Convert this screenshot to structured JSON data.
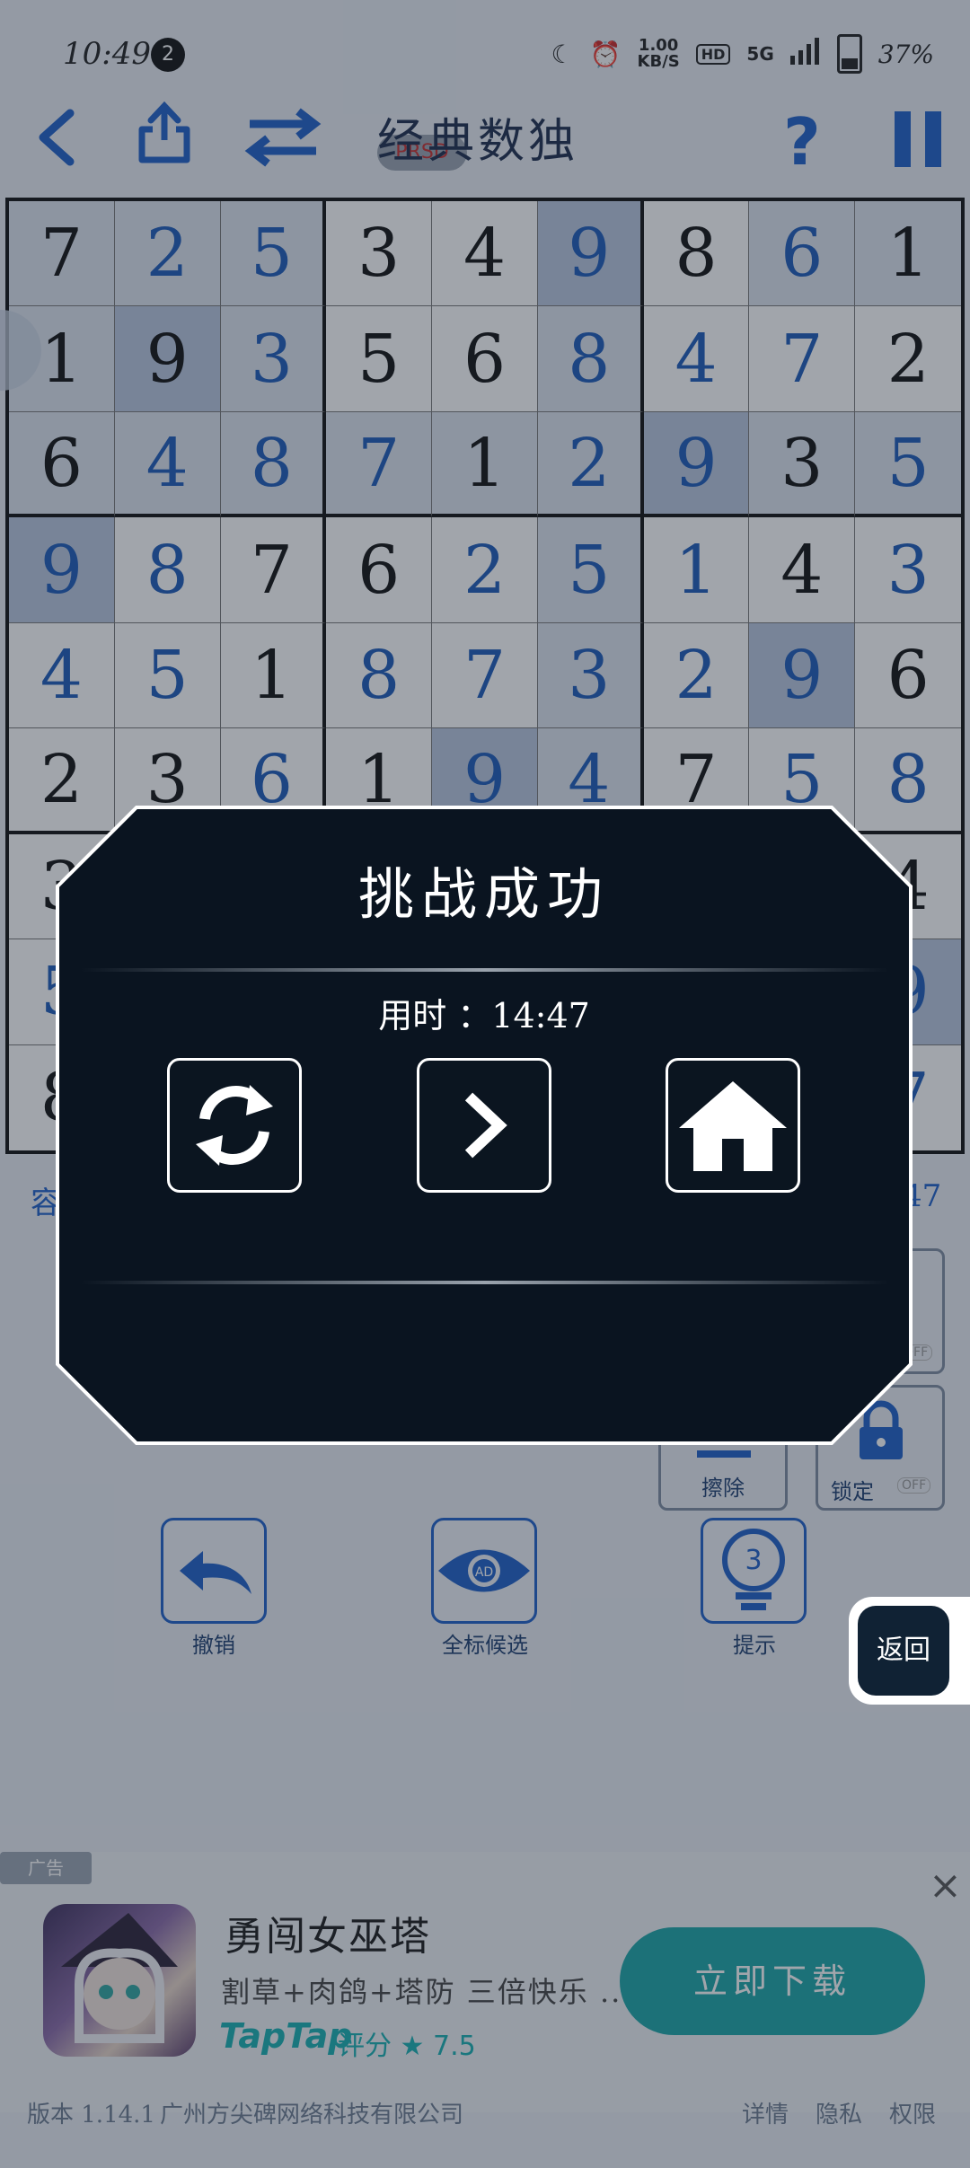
{
  "status_bar": {
    "time": "10:49",
    "notification_count": "2",
    "speed_value": "1.00",
    "speed_unit": "KB/S",
    "hd": "HD",
    "network": "5G",
    "battery": "37%"
  },
  "toolbar": {
    "title": "经典数独",
    "badge": "PRSD",
    "help": "?"
  },
  "grid": {
    "rows": [
      [
        {
          "v": "7",
          "t": "given",
          "bg": "hl"
        },
        {
          "v": "2",
          "t": "entered",
          "bg": "hl"
        },
        {
          "v": "5",
          "t": "entered",
          "bg": "hl"
        },
        {
          "v": "3",
          "t": "given",
          "bg": ""
        },
        {
          "v": "4",
          "t": "given",
          "bg": ""
        },
        {
          "v": "9",
          "t": "entered",
          "bg": "sel"
        },
        {
          "v": "8",
          "t": "given",
          "bg": ""
        },
        {
          "v": "6",
          "t": "entered",
          "bg": "hl"
        },
        {
          "v": "1",
          "t": "given",
          "bg": "hl"
        }
      ],
      [
        {
          "v": "1",
          "t": "given",
          "bg": "hl"
        },
        {
          "v": "9",
          "t": "given",
          "bg": "sel"
        },
        {
          "v": "3",
          "t": "entered",
          "bg": "hl"
        },
        {
          "v": "5",
          "t": "given",
          "bg": ""
        },
        {
          "v": "6",
          "t": "given",
          "bg": ""
        },
        {
          "v": "8",
          "t": "entered",
          "bg": "hl"
        },
        {
          "v": "4",
          "t": "entered",
          "bg": ""
        },
        {
          "v": "7",
          "t": "entered",
          "bg": ""
        },
        {
          "v": "2",
          "t": "given",
          "bg": ""
        }
      ],
      [
        {
          "v": "6",
          "t": "given",
          "bg": "hl"
        },
        {
          "v": "4",
          "t": "entered",
          "bg": "hl"
        },
        {
          "v": "8",
          "t": "entered",
          "bg": "hl"
        },
        {
          "v": "7",
          "t": "entered",
          "bg": "hl"
        },
        {
          "v": "1",
          "t": "given",
          "bg": "hl"
        },
        {
          "v": "2",
          "t": "entered",
          "bg": "hl"
        },
        {
          "v": "9",
          "t": "entered",
          "bg": "sel"
        },
        {
          "v": "3",
          "t": "given",
          "bg": "hl"
        },
        {
          "v": "5",
          "t": "entered",
          "bg": "hl"
        }
      ],
      [
        {
          "v": "9",
          "t": "entered",
          "bg": "sel"
        },
        {
          "v": "8",
          "t": "entered",
          "bg": ""
        },
        {
          "v": "7",
          "t": "given",
          "bg": ""
        },
        {
          "v": "6",
          "t": "given",
          "bg": ""
        },
        {
          "v": "2",
          "t": "entered",
          "bg": ""
        },
        {
          "v": "5",
          "t": "entered",
          "bg": "hl"
        },
        {
          "v": "1",
          "t": "entered",
          "bg": ""
        },
        {
          "v": "4",
          "t": "given",
          "bg": ""
        },
        {
          "v": "3",
          "t": "entered",
          "bg": ""
        }
      ],
      [
        {
          "v": "4",
          "t": "entered",
          "bg": ""
        },
        {
          "v": "5",
          "t": "entered",
          "bg": ""
        },
        {
          "v": "1",
          "t": "given",
          "bg": ""
        },
        {
          "v": "8",
          "t": "entered",
          "bg": ""
        },
        {
          "v": "7",
          "t": "entered",
          "bg": ""
        },
        {
          "v": "3",
          "t": "entered",
          "bg": "hl"
        },
        {
          "v": "2",
          "t": "entered",
          "bg": ""
        },
        {
          "v": "9",
          "t": "entered",
          "bg": "sel"
        },
        {
          "v": "6",
          "t": "given",
          "bg": ""
        }
      ],
      [
        {
          "v": "2",
          "t": "given",
          "bg": ""
        },
        {
          "v": "3",
          "t": "given",
          "bg": ""
        },
        {
          "v": "6",
          "t": "entered",
          "bg": ""
        },
        {
          "v": "1",
          "t": "given",
          "bg": ""
        },
        {
          "v": "9",
          "t": "entered",
          "bg": "sel"
        },
        {
          "v": "4",
          "t": "entered",
          "bg": "hl"
        },
        {
          "v": "7",
          "t": "given",
          "bg": ""
        },
        {
          "v": "5",
          "t": "entered",
          "bg": ""
        },
        {
          "v": "8",
          "t": "entered",
          "bg": ""
        }
      ],
      [
        {
          "v": "3",
          "t": "given",
          "bg": ""
        },
        {
          "v": "",
          "t": "given",
          "bg": ""
        },
        {
          "v": "",
          "t": "given",
          "bg": ""
        },
        {
          "v": "",
          "t": "given",
          "bg": ""
        },
        {
          "v": "",
          "t": "given",
          "bg": ""
        },
        {
          "v": "",
          "t": "given",
          "bg": "hl"
        },
        {
          "v": "",
          "t": "given",
          "bg": ""
        },
        {
          "v": "",
          "t": "given",
          "bg": ""
        },
        {
          "v": "4",
          "t": "given",
          "bg": ""
        }
      ],
      [
        {
          "v": "5",
          "t": "entered",
          "bg": ""
        },
        {
          "v": "",
          "t": "given",
          "bg": ""
        },
        {
          "v": "",
          "t": "given",
          "bg": ""
        },
        {
          "v": "",
          "t": "given",
          "bg": ""
        },
        {
          "v": "",
          "t": "given",
          "bg": ""
        },
        {
          "v": "",
          "t": "given",
          "bg": "hl"
        },
        {
          "v": "",
          "t": "given",
          "bg": ""
        },
        {
          "v": "",
          "t": "given",
          "bg": ""
        },
        {
          "v": "9",
          "t": "entered",
          "bg": "sel"
        }
      ],
      [
        {
          "v": "8",
          "t": "given",
          "bg": ""
        },
        {
          "v": "",
          "t": "given",
          "bg": ""
        },
        {
          "v": "",
          "t": "given",
          "bg": ""
        },
        {
          "v": "",
          "t": "given",
          "bg": ""
        },
        {
          "v": "",
          "t": "given",
          "bg": ""
        },
        {
          "v": "",
          "t": "given",
          "bg": "hl"
        },
        {
          "v": "",
          "t": "given",
          "bg": ""
        },
        {
          "v": "",
          "t": "given",
          "bg": ""
        },
        {
          "v": "7",
          "t": "entered",
          "bg": ""
        }
      ]
    ]
  },
  "below_grid": {
    "difficulty_partial": "容",
    "timer_partial": "47"
  },
  "controls": {
    "erase": "擦除",
    "lock": "锁定",
    "lock_state": "OFF",
    "toggle_state": "OFF",
    "undo": "撤销",
    "mark_all": "全标候选",
    "mark_all_ad": "AD",
    "hint": "提示",
    "hint_count": "3"
  },
  "dialog": {
    "title": "挑战成功",
    "time_label": "用时 ：14:47",
    "buttons": [
      "replay",
      "next",
      "home"
    ]
  },
  "floating": {
    "back_label": "返回"
  },
  "ad": {
    "tag": "广告",
    "title": "勇闯女巫塔",
    "subtitle": "割草+肉鸽+塔防 三倍快乐 ...",
    "brand": "TapTap",
    "rating_label": "评分",
    "rating_value": "7.5",
    "cta": "立即下载",
    "close": "×"
  },
  "footer": {
    "version": "版本 1.14.1",
    "company": "广州方尖碑网络科技有限公司",
    "details": "详情",
    "privacy": "隐私",
    "permissions": "权限"
  }
}
